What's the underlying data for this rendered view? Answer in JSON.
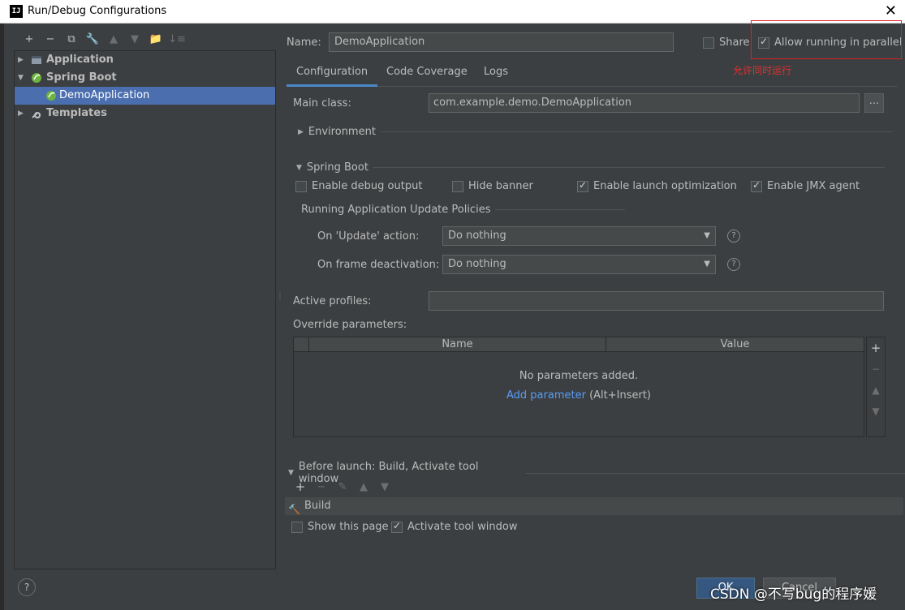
{
  "window": {
    "title": "Run/Debug Configurations",
    "app_icon": "IJ",
    "close": "✕"
  },
  "toolbar": [
    "+",
    "−",
    "⧉",
    "🔧",
    "▲",
    "▼",
    "📁",
    "↓≡"
  ],
  "tree": {
    "items": [
      {
        "label": "Application",
        "icon": "application-icon",
        "arrow": "▶"
      },
      {
        "label": "Spring Boot",
        "icon": "spring-boot-icon",
        "arrow": "▼"
      },
      {
        "label": "DemoApplication",
        "icon": "spring-boot-icon"
      },
      {
        "label": "Templates",
        "icon": "wrench-icon",
        "arrow": "▶"
      }
    ]
  },
  "help": "?",
  "name": {
    "label": "Name:",
    "value": "DemoApplication"
  },
  "share": {
    "label": "Share",
    "checked": false
  },
  "parallel": {
    "label": "Allow running in parallel",
    "checked": true,
    "note": "允许同时运行"
  },
  "tabs": [
    "Configuration",
    "Code Coverage",
    "Logs"
  ],
  "main_class": {
    "label": "Main class:",
    "value": "com.example.demo.DemoApplication",
    "browse": "..."
  },
  "environment": {
    "label": "Environment",
    "arrow": "▶"
  },
  "spring_boot": {
    "label": "Spring Boot",
    "arrow": "▼",
    "options": [
      {
        "label": "Enable debug output",
        "checked": false
      },
      {
        "label": "Hide banner",
        "checked": false
      },
      {
        "label": "Enable launch optimization",
        "checked": true
      },
      {
        "label": "Enable JMX agent",
        "checked": true
      }
    ],
    "policies_label": "Running Application Update Policies",
    "update_action": {
      "label": "On 'Update' action:",
      "value": "Do nothing"
    },
    "frame_deactivation": {
      "label": "On frame deactivation:",
      "value": "Do nothing"
    }
  },
  "active_profiles": {
    "label": "Active profiles:",
    "value": ""
  },
  "override": {
    "label": "Override parameters:",
    "columns": [
      "Name",
      "Value"
    ],
    "empty": "No parameters added.",
    "add_link": "Add parameter",
    "shortcut": "(Alt+Insert)"
  },
  "side_tools": [
    "+",
    "−",
    "▲",
    "▼"
  ],
  "before_launch": {
    "label": "Before launch: Build, Activate tool window",
    "arrow": "▼",
    "tools": [
      "+",
      "−",
      "✎",
      "▲",
      "▼"
    ],
    "task": "Build"
  },
  "show_page": {
    "label": "Show this page",
    "checked": false
  },
  "activate_window": {
    "label": "Activate tool window",
    "checked": true
  },
  "buttons": {
    "ok": "OK",
    "cancel": "Cancel"
  },
  "watermark": "CSDN @不写bug的程序媛"
}
